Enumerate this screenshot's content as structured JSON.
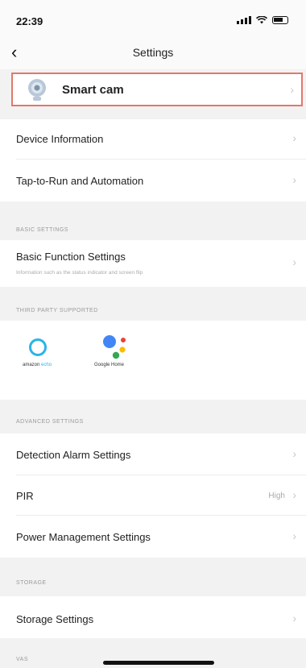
{
  "status_bar": {
    "time": "22:39"
  },
  "nav": {
    "title": "Settings"
  },
  "device": {
    "name": "Smart cam"
  },
  "rows_top": {
    "device_info": "Device Information",
    "tap_to_run": "Tap-to-Run and Automation"
  },
  "sections": {
    "basic": "BASIC SETTINGS",
    "third_party": "THIRD PARTY SUPPORTED",
    "advanced": "ADVANCED SETTINGS",
    "storage": "STORAGE",
    "vas": "VAS"
  },
  "basic": {
    "label": "Basic Function Settings",
    "sub": "Information such as the status indicator and screen flip"
  },
  "third_party": {
    "alexa_brand": "amazon",
    "alexa_product": "echo",
    "google_label": "Google Home"
  },
  "advanced": {
    "detection": "Detection Alarm Settings",
    "pir": "PIR",
    "pir_value": "High",
    "power": "Power Management Settings"
  },
  "storage": {
    "label": "Storage Settings"
  },
  "icons": {
    "back": "chevron-left-icon",
    "chevron": "chevron-right-icon",
    "camera": "camera-icon",
    "alexa": "alexa-icon",
    "google": "google-assistant-icon"
  },
  "colors": {
    "highlight_border": "#e5766a",
    "alexa_blue": "#2ab4e8",
    "google_blue": "#4285f4",
    "google_red": "#ea4335",
    "google_yellow": "#fbbc05",
    "google_green": "#34a853"
  }
}
